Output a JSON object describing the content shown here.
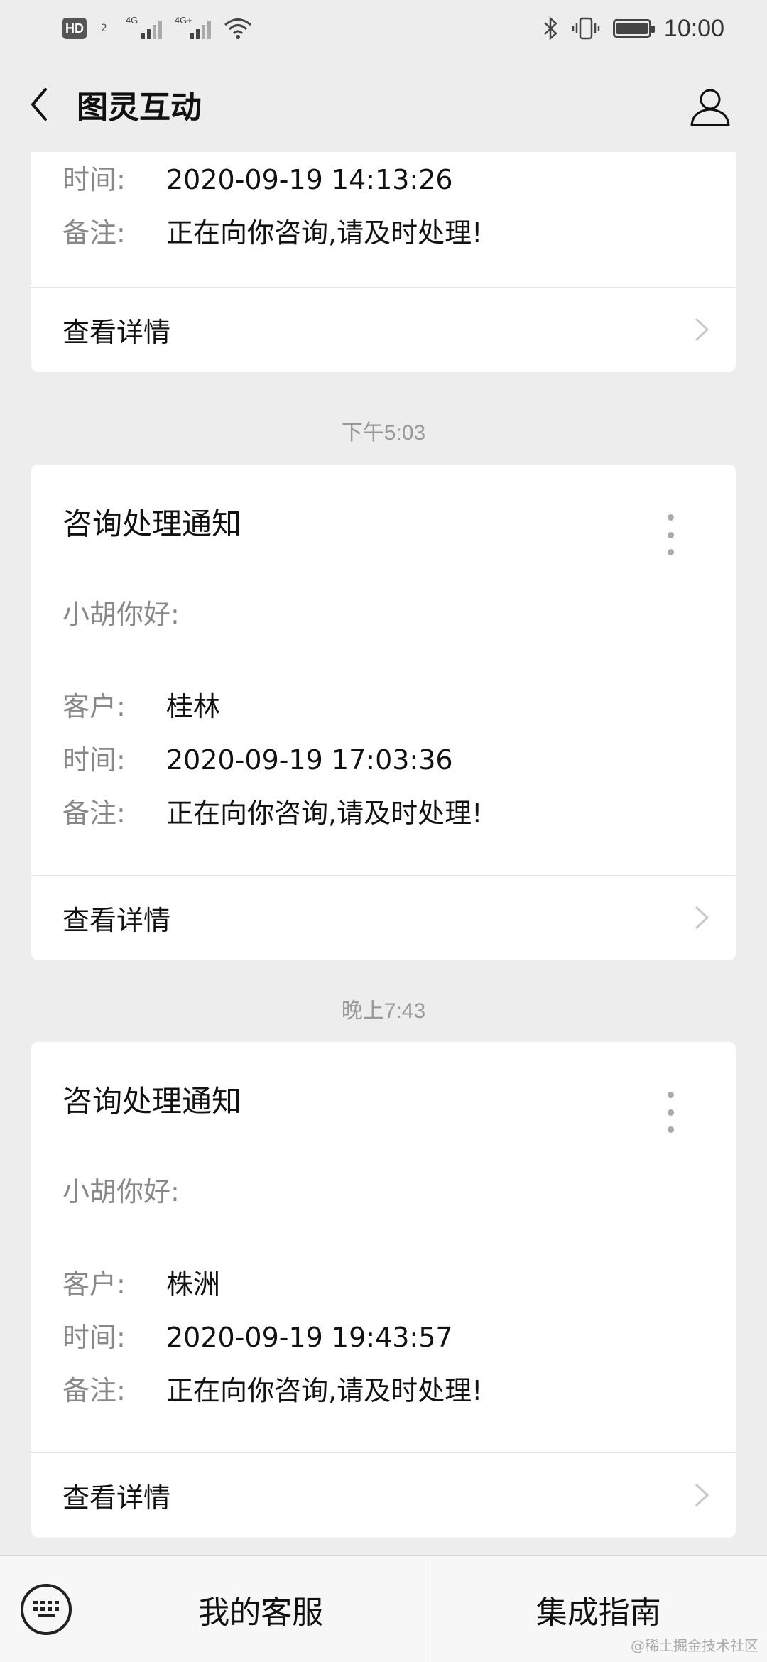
{
  "status_bar": {
    "hd_label": "HD",
    "hd_sub": "2",
    "net1": "4G",
    "net2": "4G+",
    "time": "10:00"
  },
  "nav": {
    "title": "图灵互动"
  },
  "messages": [
    {
      "partial": true,
      "fields": [
        {
          "label": "时间:",
          "value": "2020-09-19 14:13:26"
        },
        {
          "label": "备注:",
          "value": "正在向你咨询,请及时处理!"
        }
      ],
      "detail_label": "查看详情"
    },
    {
      "time_sep": "下午5:03",
      "title": "咨询处理通知",
      "greeting": "小胡你好:",
      "fields": [
        {
          "label": "客户:",
          "value": "桂林"
        },
        {
          "label": "时间:",
          "value": "2020-09-19 17:03:36"
        },
        {
          "label": "备注:",
          "value": "正在向你咨询,请及时处理!"
        }
      ],
      "detail_label": "查看详情"
    },
    {
      "time_sep": "晚上7:43",
      "title": "咨询处理通知",
      "greeting": "小胡你好:",
      "fields": [
        {
          "label": "客户:",
          "value": "株洲"
        },
        {
          "label": "时间:",
          "value": "2020-09-19 19:43:57"
        },
        {
          "label": "备注:",
          "value": "正在向你咨询,请及时处理!"
        }
      ],
      "detail_label": "查看详情"
    }
  ],
  "bottom_bar": {
    "menu": [
      {
        "label": "我的客服"
      },
      {
        "label": "集成指南"
      }
    ],
    "watermark": "@稀土掘金技术社区"
  },
  "colors": {
    "background": "#ededed",
    "card": "#ffffff",
    "muted_text": "#888888"
  }
}
